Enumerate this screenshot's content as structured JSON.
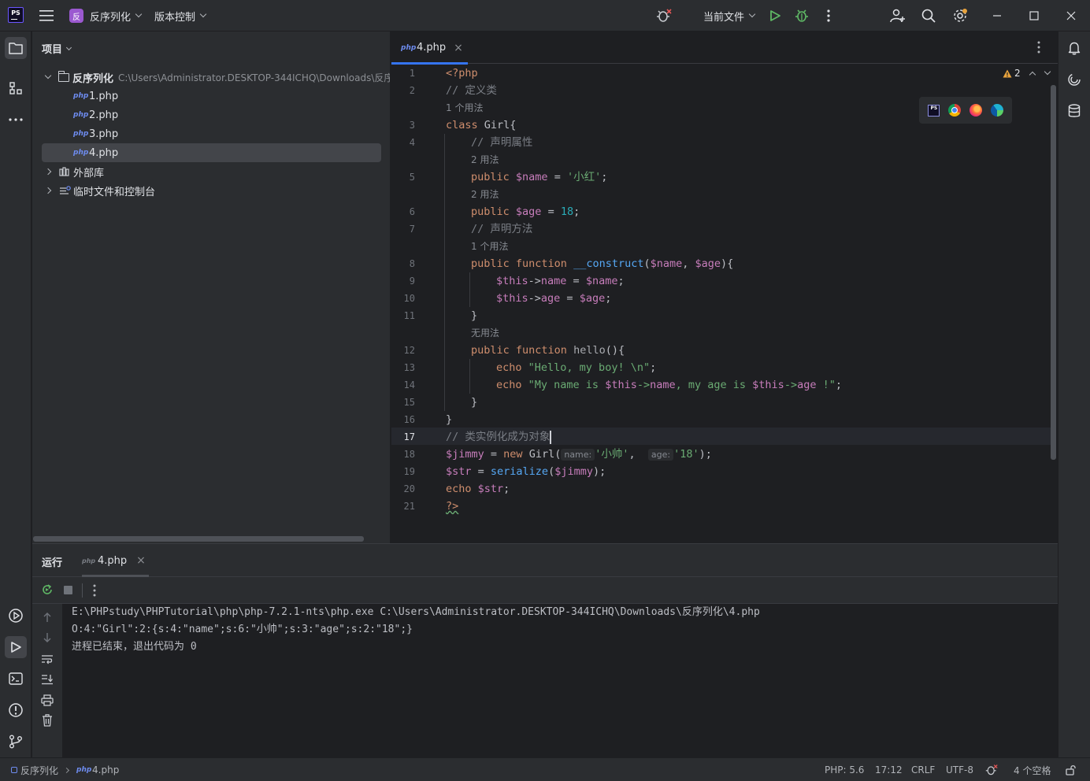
{
  "titlebar": {
    "project_badge": "反",
    "project_name": "反序列化",
    "vcs_label": "版本控制",
    "run_config": "当前文件"
  },
  "project_panel": {
    "title": "项目",
    "root": {
      "name": "反序列化",
      "path": "C:\\Users\\Administrator.DESKTOP-344ICHQ\\Downloads\\反序列化"
    },
    "files": [
      "1.php",
      "2.php",
      "3.php",
      "4.php"
    ],
    "selected_file": "4.php",
    "external_libraries": "外部库",
    "scratches": "临时文件和控制台"
  },
  "editor": {
    "tab": {
      "icon": "php",
      "label": "4.php"
    },
    "warnings_count": "2",
    "line_numbers": [
      "1",
      "2",
      "3",
      "4",
      "5",
      "6",
      "7",
      "8",
      "9",
      "10",
      "11",
      "12",
      "13",
      "14",
      "15",
      "16",
      "17",
      "18",
      "19",
      "20",
      "21"
    ],
    "usage_hints": {
      "class": "1 个用法",
      "name": "2 用法",
      "age": "2 用法",
      "construct": "1 个用法",
      "hello": "无用法"
    },
    "param_hints": {
      "name": "name:",
      "age": "age:"
    },
    "code": {
      "l1": "<?php",
      "l2": "// 定义类",
      "l3_kw": "class",
      "l3_rest": " Girl{",
      "l4": "// 声明属性",
      "l5_kw": "public",
      "l5_var": "$name",
      "l5_eq": " = ",
      "l5_str": "'小红'",
      "l5_end": ";",
      "l6_kw": "public",
      "l6_var": "$age",
      "l6_eq": " = ",
      "l6_num": "18",
      "l6_end": ";",
      "l7": "// 声明方法",
      "l8_kw": "public function",
      "l8_fn": "__construct",
      "l8_p1": "$name",
      "l8_p2": "$age",
      "l9_this": "$this",
      "l9_prop": "name",
      "l9_var": "$name",
      "l10_this": "$this",
      "l10_prop": "age",
      "l10_var": "$age",
      "l11": "}",
      "l12_kw": "public function",
      "l12_fn": "hello",
      "l12_end": "(){",
      "l13_kw": "echo",
      "l13_str": "\"Hello, my boy! \\n\"",
      "l14_kw": "echo",
      "l14_s1": "\"My name is ",
      "l14_this1": "$this",
      "l14_p1": "name",
      "l14_s2": ", my age is ",
      "l14_this2": "$this",
      "l14_p2": "age",
      "l14_s3": " !\"",
      "l15": "}",
      "l16": "}",
      "l17": "// 类实例化成为对象",
      "l18_var": "$jimmy",
      "l18_kw": "new",
      "l18_cls": " Girl(",
      "l18_s1": "'小帅'",
      "l18_s2": "'18'",
      "l18_end": ");",
      "l19_var": "$str",
      "l19_fn": "serialize",
      "l19_arg": "$jimmy",
      "l20_kw": "echo",
      "l20_var": "$str",
      "l21": "?>"
    }
  },
  "run_panel": {
    "title": "运行",
    "tab_label": "4.php",
    "output": [
      "E:\\PHPstudy\\PHPTutorial\\php\\php-7.2.1-nts\\php.exe C:\\Users\\Administrator.DESKTOP-344ICHQ\\Downloads\\反序列化\\4.php",
      "O:4:\"Girl\":2:{s:4:\"name\";s:6:\"小帅\";s:3:\"age\";s:2:\"18\";}",
      "进程已结束，退出代码为 0"
    ]
  },
  "statusbar": {
    "breadcrumb_project": "反序列化",
    "breadcrumb_file": "4.php",
    "php_version": "PHP: 5.6",
    "cursor": "17:12",
    "line_sep": "CRLF",
    "encoding": "UTF-8",
    "indent": "4 个空格"
  },
  "colors": {
    "accent": "#3574f0",
    "run_green": "#5fb865",
    "badge_purple": "#9b59d0",
    "keyword": "#cf8e6d",
    "string": "#6aab73",
    "variable": "#c77dbb"
  }
}
